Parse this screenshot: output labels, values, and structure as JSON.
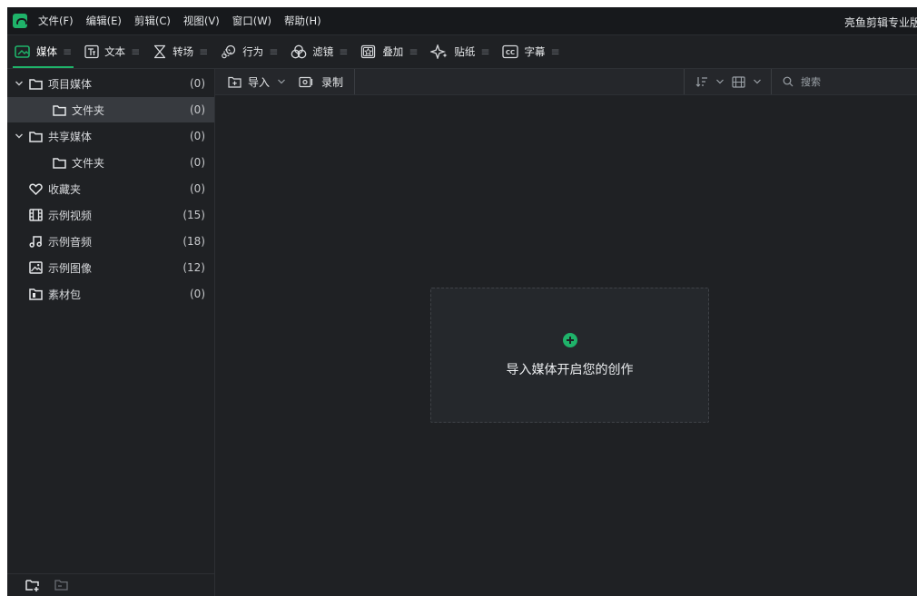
{
  "menubar": {
    "items": [
      "文件(F)",
      "编辑(E)",
      "剪辑(C)",
      "视图(V)",
      "窗口(W)",
      "帮助(H)"
    ],
    "app_title": "亮鱼剪辑专业版"
  },
  "tabs": [
    {
      "label": "媒体",
      "icon": "media-icon",
      "active": true
    },
    {
      "label": "文本",
      "icon": "text-icon"
    },
    {
      "label": "转场",
      "icon": "hourglass-icon"
    },
    {
      "label": "行为",
      "icon": "behavior-icon"
    },
    {
      "label": "滤镜",
      "icon": "filter-icon"
    },
    {
      "label": "叠加",
      "icon": "overlay-icon"
    },
    {
      "label": "贴纸",
      "icon": "sparkle-icon"
    },
    {
      "label": "字幕",
      "icon": "cc-icon"
    }
  ],
  "tab_handle": "≡",
  "sidebar": {
    "items": [
      {
        "label": "项目媒体",
        "count": "(0)"
      },
      {
        "label": "文件夹",
        "count": "(0)"
      },
      {
        "label": "共享媒体",
        "count": "(0)"
      },
      {
        "label": "文件夹",
        "count": "(0)"
      },
      {
        "label": "收藏夹",
        "count": "(0)"
      },
      {
        "label": "示例视频",
        "count": "(15)"
      },
      {
        "label": "示例音频",
        "count": "(18)"
      },
      {
        "label": "示例图像",
        "count": "(12)"
      },
      {
        "label": "素材包",
        "count": "(0)"
      }
    ]
  },
  "toolbar": {
    "import_label": "导入",
    "record_label": "录制",
    "search_placeholder": "搜索"
  },
  "dropzone": {
    "text": "导入媒体开启您的创作"
  },
  "colors": {
    "accent": "#1fb36a",
    "background": "#1f2124",
    "selected_row": "#373a3f"
  }
}
